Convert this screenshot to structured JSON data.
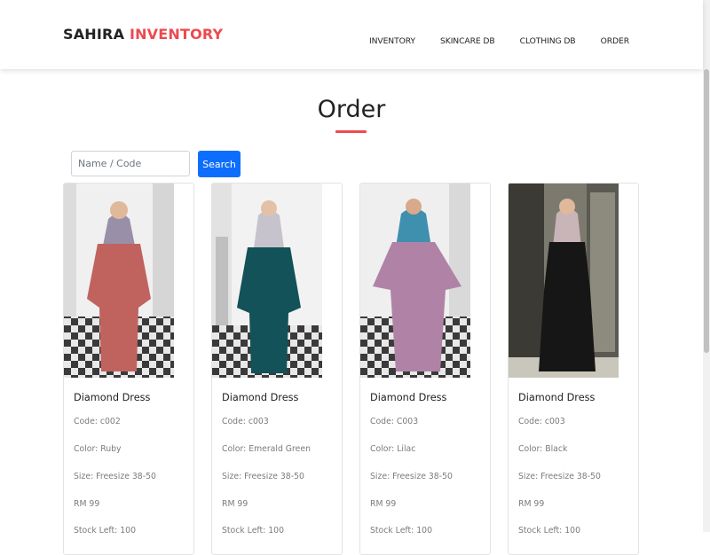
{
  "brand": {
    "part1": "SAHIRA ",
    "part2": "INVENTORY"
  },
  "nav": [
    {
      "label": "INVENTORY"
    },
    {
      "label": "SKINCARE DB"
    },
    {
      "label": "CLOTHING DB"
    },
    {
      "label": "ORDER"
    }
  ],
  "page": {
    "title": "Order"
  },
  "search": {
    "placeholder": "Name / Code",
    "value": "",
    "button_label": "Search"
  },
  "colors": {
    "accent": "#ee4a4e",
    "primary_button": "#0d6efd"
  },
  "products": [
    {
      "name": "Diamond Dress",
      "code": "Code: c002",
      "color": "Color: Ruby",
      "size": "Size: Freesize 38-50",
      "price": "RM 99",
      "stock": "Stock Left: 100"
    },
    {
      "name": "Diamond Dress",
      "code": "Code: c003",
      "color": "Color: Emerald Green",
      "size": "Size: Freesize 38-50",
      "price": "RM 99",
      "stock": "Stock Left: 100"
    },
    {
      "name": "Diamond Dress",
      "code": "Code: C003",
      "color": "Color: Lilac",
      "size": "Size: Freesize 38-50",
      "price": "RM 99",
      "stock": "Stock Left: 100"
    },
    {
      "name": "Diamond Dress",
      "code": "Code: c003",
      "color": "Color: Black",
      "size": "Size: Freesize 38-50",
      "price": "RM 99",
      "stock": "Stock Left: 100"
    }
  ]
}
